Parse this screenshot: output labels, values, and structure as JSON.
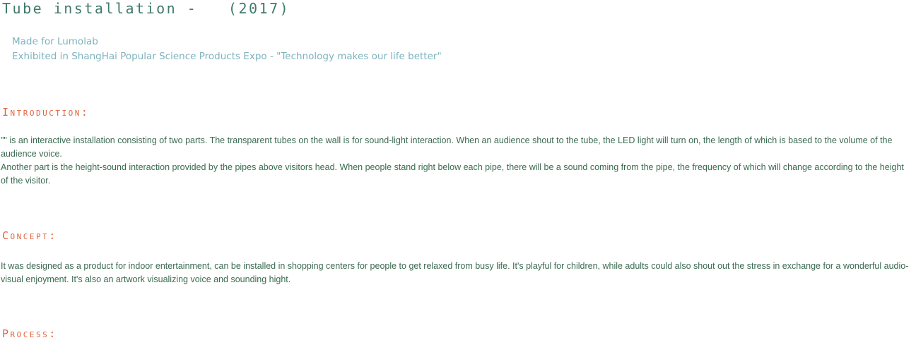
{
  "header": {
    "title": "Tube installation -   (2017)",
    "made_for": "Made for Lumolab",
    "exhibited": "Exhibited in ShangHai Popular Science Products Expo - \"Technology makes our life better\""
  },
  "sections": {
    "introduction": {
      "heading": "Introduction:",
      "paragraph1": "\"\" is an interactive installation consisting of two parts. The transparent tubes on the wall is for sound-light interaction. When an audience shout to the tube, the LED light will turn on, the length of which is based to the volume of the audience voice.",
      "paragraph2": "Another part is the height-sound interaction provided by the pipes above visitors head. When people stand right below each pipe, there will be a sound coming from the pipe, the frequency of which will change according to the height of the visitor."
    },
    "concept": {
      "heading": "Concept:",
      "paragraph1": "It was designed as a product for indoor entertainment, can be installed in shopping centers for people to get relaxed from busy life. It's playful for children, while adults could also shout out the stress in exchange for a wonderful audio-visual enjoyment. It's also an artwork visualizing voice and sounding hight."
    },
    "process": {
      "heading": "Process:"
    }
  }
}
